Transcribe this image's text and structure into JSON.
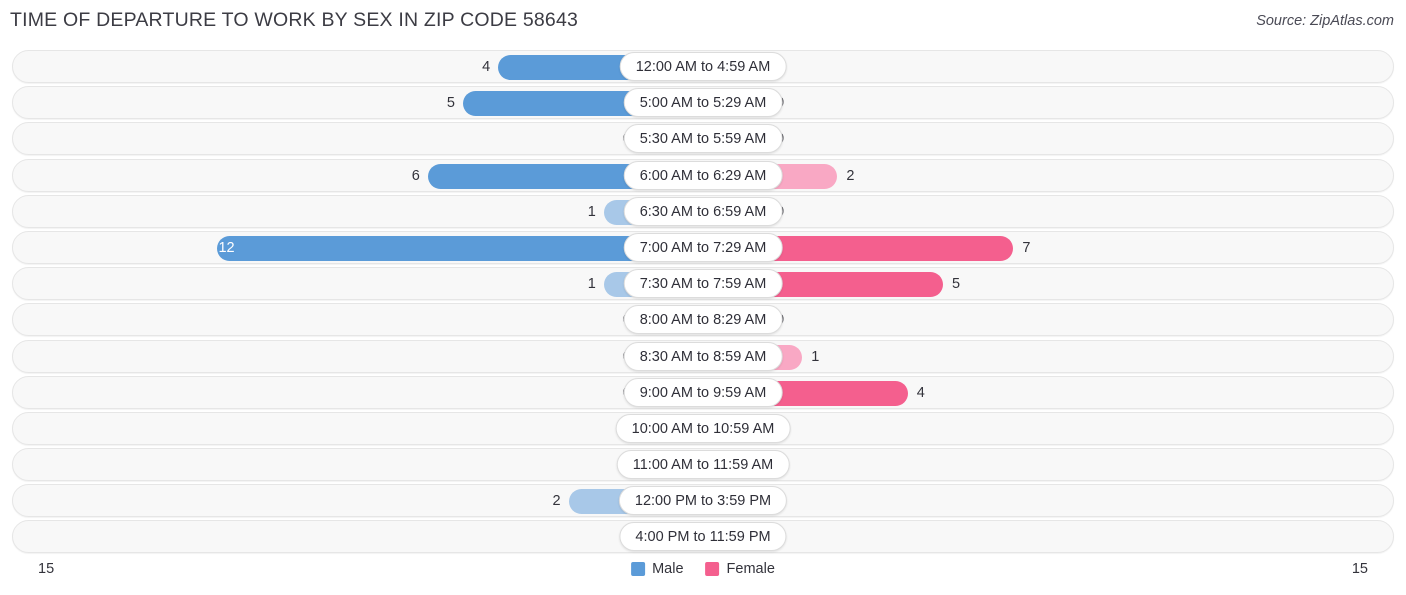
{
  "header": {
    "title": "TIME OF DEPARTURE TO WORK BY SEX IN ZIP CODE 58643",
    "source": "Source: ZipAtlas.com"
  },
  "legend": {
    "male_label": "Male",
    "female_label": "Female",
    "male_color": "#5b9bd8",
    "female_color": "#f45f8e"
  },
  "axis": {
    "left_max": "15",
    "right_max": "15"
  },
  "colors": {
    "male_strong": "#5b9bd8",
    "male_light": "#a8c8e8",
    "female_strong": "#f45f8e",
    "female_light": "#f9a8c4",
    "row_background": "#f8f8f8",
    "row_border": "#e6e6e6"
  },
  "chart_data": {
    "type": "bar",
    "orientation": "horizontal",
    "layout": "diverging-paired",
    "title": "TIME OF DEPARTURE TO WORK BY SEX IN ZIP CODE 58643",
    "xlabel": "",
    "ylabel": "",
    "xlim": [
      0,
      15
    ],
    "grid": false,
    "legend_position": "bottom-center",
    "categories": [
      "12:00 AM to 4:59 AM",
      "5:00 AM to 5:29 AM",
      "5:30 AM to 5:59 AM",
      "6:00 AM to 6:29 AM",
      "6:30 AM to 6:59 AM",
      "7:00 AM to 7:29 AM",
      "7:30 AM to 7:59 AM",
      "8:00 AM to 8:29 AM",
      "8:30 AM to 8:59 AM",
      "9:00 AM to 9:59 AM",
      "10:00 AM to 10:59 AM",
      "11:00 AM to 11:59 AM",
      "12:00 PM to 3:59 PM",
      "4:00 PM to 11:59 PM"
    ],
    "series": [
      {
        "name": "Male",
        "values": [
          4,
          5,
          0,
          6,
          1,
          12,
          1,
          0,
          0,
          0,
          0,
          0,
          2,
          0
        ]
      },
      {
        "name": "Female",
        "values": [
          0,
          0,
          0,
          2,
          0,
          7,
          5,
          0,
          1,
          4,
          0,
          0,
          0,
          0
        ]
      }
    ]
  },
  "rows": [
    {
      "label": "12:00 AM to 4:59 AM",
      "male": "4",
      "female": "0"
    },
    {
      "label": "5:00 AM to 5:29 AM",
      "male": "5",
      "female": "0"
    },
    {
      "label": "5:30 AM to 5:59 AM",
      "male": "0",
      "female": "0"
    },
    {
      "label": "6:00 AM to 6:29 AM",
      "male": "6",
      "female": "2"
    },
    {
      "label": "6:30 AM to 6:59 AM",
      "male": "1",
      "female": "0"
    },
    {
      "label": "7:00 AM to 7:29 AM",
      "male": "12",
      "female": "7"
    },
    {
      "label": "7:30 AM to 7:59 AM",
      "male": "1",
      "female": "5"
    },
    {
      "label": "8:00 AM to 8:29 AM",
      "male": "0",
      "female": "0"
    },
    {
      "label": "8:30 AM to 8:59 AM",
      "male": "0",
      "female": "1"
    },
    {
      "label": "9:00 AM to 9:59 AM",
      "male": "0",
      "female": "4"
    },
    {
      "label": "10:00 AM to 10:59 AM",
      "male": "0",
      "female": "0"
    },
    {
      "label": "11:00 AM to 11:59 AM",
      "male": "0",
      "female": "0"
    },
    {
      "label": "12:00 PM to 3:59 PM",
      "male": "2",
      "female": "0"
    },
    {
      "label": "4:00 PM to 11:59 PM",
      "male": "0",
      "female": "0"
    }
  ]
}
